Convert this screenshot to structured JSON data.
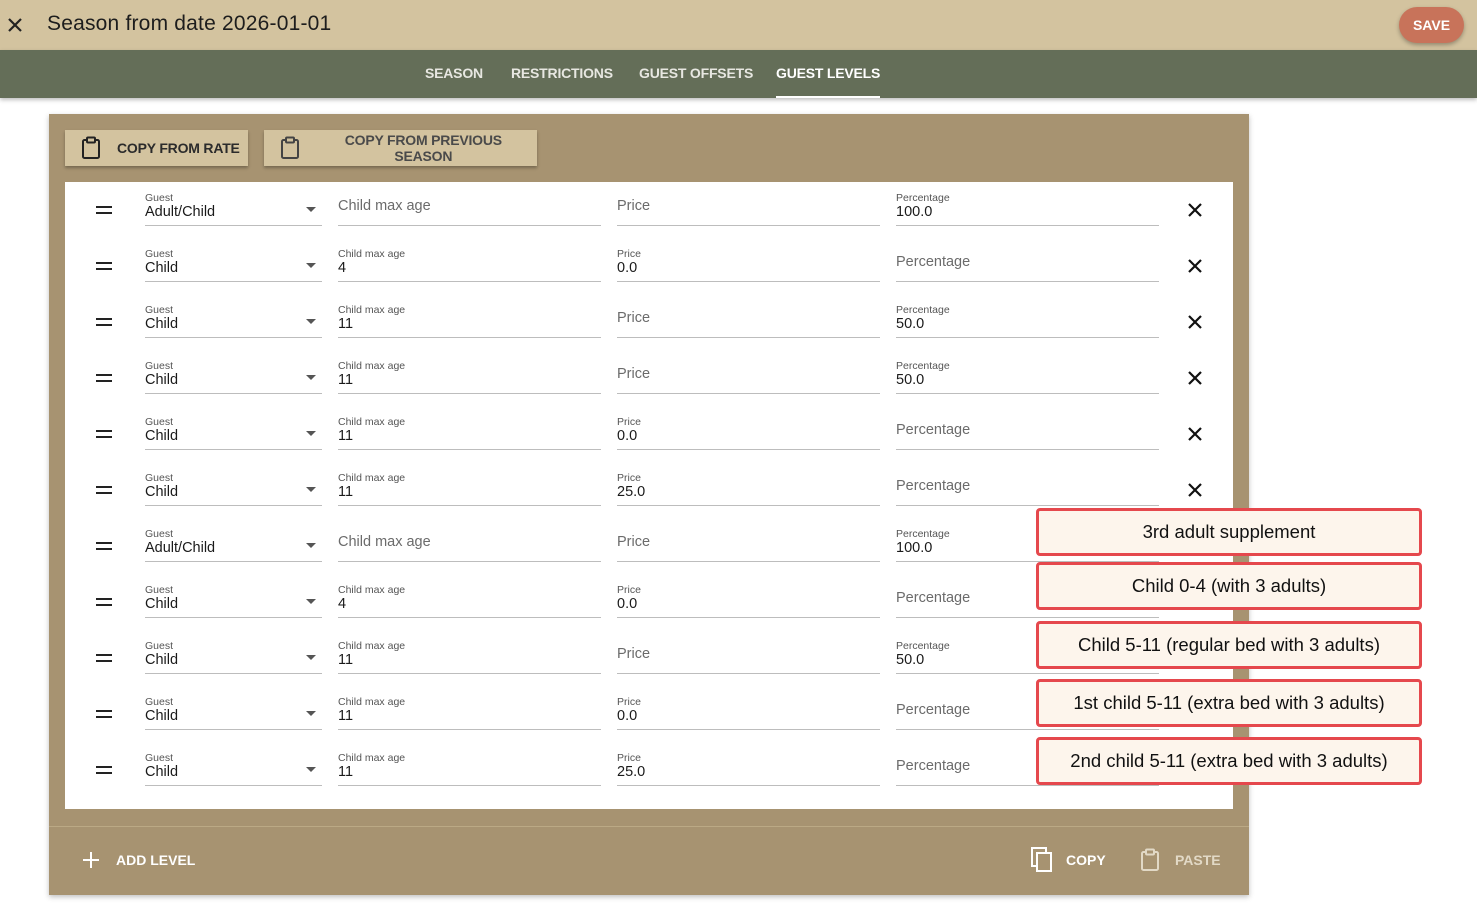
{
  "header": {
    "title": "Season from date 2026-01-01",
    "save_label": "SAVE"
  },
  "tabs": [
    {
      "label": "SEASON",
      "active": false
    },
    {
      "label": "RESTRICTIONS",
      "active": false
    },
    {
      "label": "GUEST OFFSETS",
      "active": false
    },
    {
      "label": "GUEST LEVELS",
      "active": true
    }
  ],
  "actions": {
    "copy_from_rate": "COPY FROM RATE",
    "copy_from_previous_season": "COPY FROM PREVIOUS SEASON",
    "add_level": "ADD LEVEL",
    "copy": "COPY",
    "paste": "PASTE"
  },
  "field_labels": {
    "guest": "Guest",
    "child_max_age": "Child max age",
    "price": "Price",
    "percentage": "Percentage"
  },
  "levels": [
    {
      "guest": "Adult/Child",
      "child_max_age": "",
      "price": "",
      "percentage": "100.0"
    },
    {
      "guest": "Child",
      "child_max_age": "4",
      "price": "0.0",
      "percentage": ""
    },
    {
      "guest": "Child",
      "child_max_age": "11",
      "price": "",
      "percentage": "50.0"
    },
    {
      "guest": "Child",
      "child_max_age": "11",
      "price": "",
      "percentage": "50.0"
    },
    {
      "guest": "Child",
      "child_max_age": "11",
      "price": "0.0",
      "percentage": ""
    },
    {
      "guest": "Child",
      "child_max_age": "11",
      "price": "25.0",
      "percentage": ""
    },
    {
      "guest": "Adult/Child",
      "child_max_age": "",
      "price": "",
      "percentage": "100.0"
    },
    {
      "guest": "Child",
      "child_max_age": "4",
      "price": "0.0",
      "percentage": ""
    },
    {
      "guest": "Child",
      "child_max_age": "11",
      "price": "",
      "percentage": "50.0"
    },
    {
      "guest": "Child",
      "child_max_age": "11",
      "price": "0.0",
      "percentage": ""
    },
    {
      "guest": "Child",
      "child_max_age": "11",
      "price": "25.0",
      "percentage": ""
    }
  ],
  "annotations": [
    "3rd adult supplement",
    "Child 0-4 (with 3 adults)",
    "Child 5-11 (regular bed with 3 adults)",
    "1st child 5-11 (extra bed with 3 adults)",
    "2nd child 5-11 (extra bed with 3 adults)"
  ],
  "colors": {
    "header_bg": "#d3c39f",
    "tabbar_bg": "#646e58",
    "card_bg": "#a79371",
    "save_button": "#c8735a",
    "annotation_border": "#e5484d"
  },
  "icons": {
    "close": "close-icon",
    "clipboard": "clipboard-icon",
    "drag": "drag-handle-icon",
    "remove": "remove-icon",
    "add": "plus-icon",
    "copy": "copy-icon",
    "paste": "paste-icon"
  }
}
